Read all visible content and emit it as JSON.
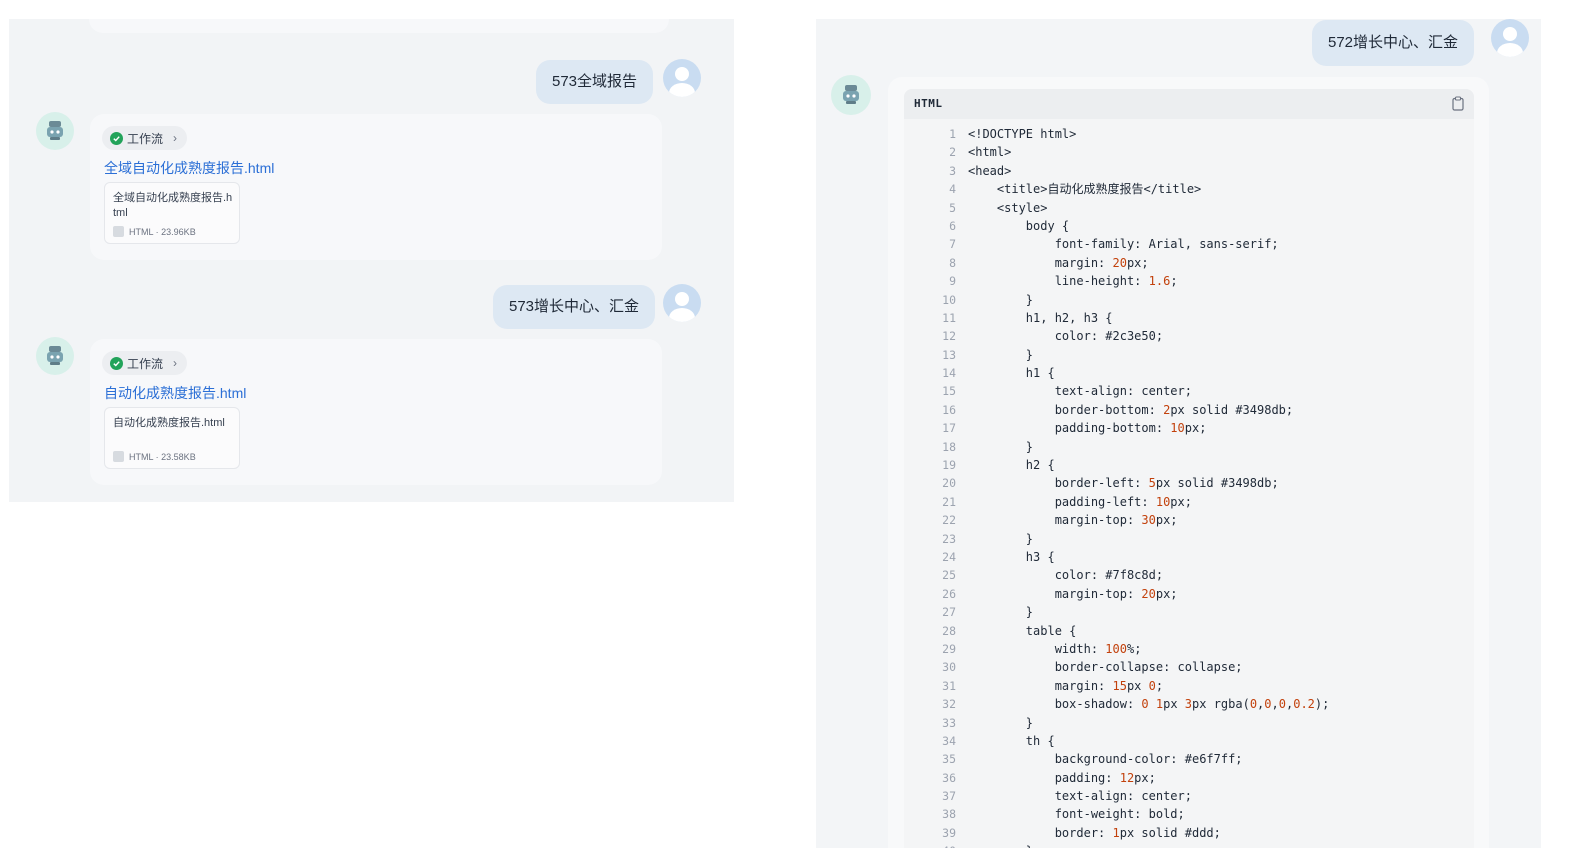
{
  "left": {
    "messages": [
      {
        "user_text": "573全域报告",
        "workflow_label": "工作流",
        "file_link": "全域自动化成熟度报告.html",
        "file_card_name": "全域自动化成熟度报告.html",
        "file_meta": "HTML · 23.96KB"
      },
      {
        "user_text": "573增长中心、汇金",
        "workflow_label": "工作流",
        "file_link": "自动化成熟度报告.html",
        "file_card_name": "自动化成熟度报告.html",
        "file_meta": "HTML · 23.58KB"
      }
    ]
  },
  "right": {
    "user_text": "572增长中心、汇金",
    "code_language": "HTML",
    "code_lines": [
      "<!DOCTYPE html>",
      "<html>",
      "<head>",
      "    <title>自动化成熟度报告</title>",
      "    <style>",
      "        body {",
      "            font-family: Arial, sans-serif;",
      "            margin: 20px;",
      "            line-height: 1.6;",
      "        }",
      "        h1, h2, h3 {",
      "            color: #2c3e50;",
      "        }",
      "        h1 {",
      "            text-align: center;",
      "            border-bottom: 2px solid #3498db;",
      "            padding-bottom: 10px;",
      "        }",
      "        h2 {",
      "            border-left: 5px solid #3498db;",
      "            padding-left: 10px;",
      "            margin-top: 30px;",
      "        }",
      "        h3 {",
      "            color: #7f8c8d;",
      "            margin-top: 20px;",
      "        }",
      "        table {",
      "            width: 100%;",
      "            border-collapse: collapse;",
      "            margin: 15px 0;",
      "            box-shadow: 0 1px 3px rgba(0,0,0,0.2);",
      "        }",
      "        th {",
      "            background-color: #e6f7ff;",
      "            padding: 12px;",
      "            text-align: center;",
      "            font-weight: bold;",
      "            border: 1px solid #ddd;",
      "        }"
    ]
  },
  "colors": {
    "link": "#2b6fd6",
    "user_bubble": "#dde8f3",
    "success": "#22a35a",
    "code_number": "#c2410c"
  }
}
